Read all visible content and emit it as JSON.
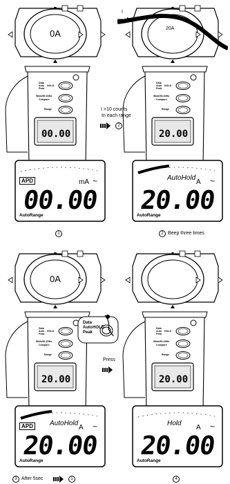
{
  "panels": [
    {
      "id": "1",
      "jaw_reading": "0A",
      "lcd_mini": "00.00",
      "big_reading": "00.00",
      "unit": "mA",
      "hold_label": "",
      "apd": "APD",
      "autorange": "AutoRange",
      "caption_num": "1",
      "caption": "",
      "show_cable": false,
      "show_bar": false
    },
    {
      "id": "2",
      "jaw_reading": "20A",
      "lcd_mini": "20.00",
      "big_reading": "20.00",
      "unit": "A",
      "hold_label": "AutoHold",
      "apd": "",
      "autorange": "AutoRange",
      "caption_num": "2",
      "caption": "Beep three times",
      "show_cable": true,
      "show_bar": true
    },
    {
      "id": "3",
      "jaw_reading": "0A",
      "lcd_mini": "20.00",
      "big_reading": "20.00",
      "unit": "A",
      "hold_label": "AutoHold",
      "apd": "APD",
      "autorange": "AutoRange",
      "caption_num": "3",
      "caption": "After 5sec",
      "caption_end_num": "1",
      "show_cable": false,
      "show_bar": true
    },
    {
      "id": "4",
      "jaw_reading": "",
      "lcd_mini": "20.00",
      "big_reading": "20.00",
      "unit": "A",
      "hold_label": "Hold",
      "apd": "",
      "autorange": "AutoRange",
      "caption_num": "4",
      "caption": "",
      "show_cable": false,
      "show_bar": false
    }
  ],
  "meter_buttons": {
    "data_hold": [
      "Data",
      "Auto",
      "Peak",
      "HOLD"
    ],
    "mode": [
      "Wide/50-60Hz",
      "Compare"
    ],
    "range": "Range"
  },
  "transition_1_2": {
    "line1": "I >10 counts",
    "line2": "In each range",
    "target": "2"
  },
  "transition_3_4": {
    "label": "Press"
  },
  "zoom_buttons": [
    "Data",
    "Auto",
    "Peak",
    "HOLD"
  ],
  "current_label": "I"
}
